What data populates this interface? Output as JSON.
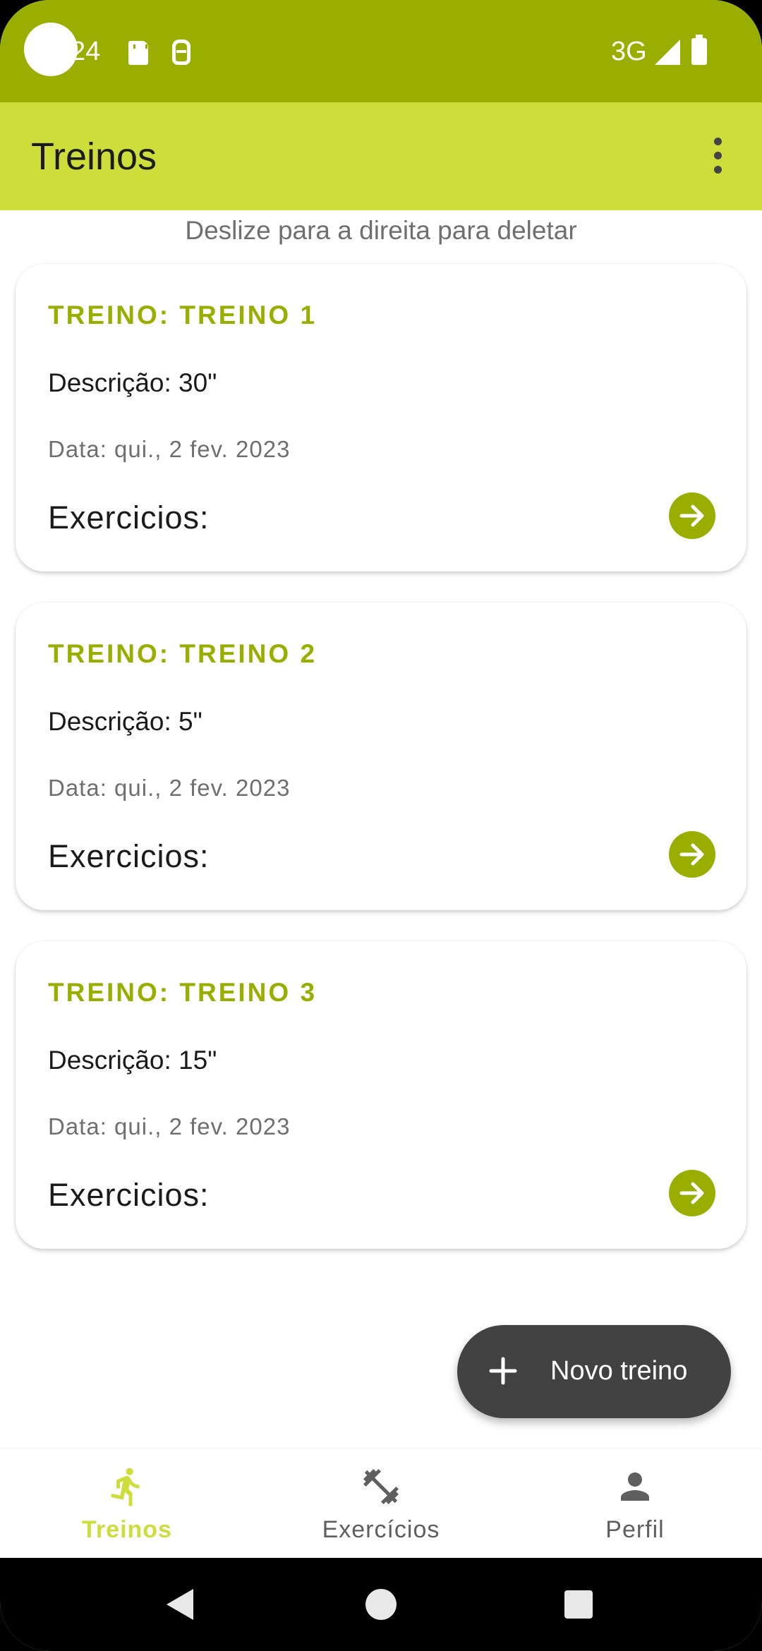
{
  "status_bar": {
    "time": "24",
    "network": "3G"
  },
  "app_bar": {
    "title": "Treinos",
    "menu_icon": "more-vert-icon"
  },
  "hint": "Deslize para a direita para deletar",
  "cards": [
    {
      "title": "TREINO: TREINO 1",
      "description": "Descrição: 30\"",
      "date": "Data: qui., 2 fev. 2023",
      "exercises": "Exercicios:",
      "action_icon": "arrow-forward-icon"
    },
    {
      "title": "TREINO: TREINO 2",
      "description": "Descrição: 5\"",
      "date": "Data: qui., 2 fev. 2023",
      "exercises": "Exercicios:",
      "action_icon": "arrow-forward-icon"
    },
    {
      "title": "TREINO: TREINO 3",
      "description": "Descrição: 15\"",
      "date": "Data: qui., 2 fev. 2023",
      "exercises": "Exercicios:",
      "action_icon": "arrow-forward-icon"
    }
  ],
  "fab": {
    "label": "Novo treino",
    "icon": "plus-icon"
  },
  "bottom_nav": {
    "items": [
      {
        "label": "Treinos",
        "icon": "running-icon",
        "active": true
      },
      {
        "label": "Exercícios",
        "icon": "dumbbell-icon",
        "active": false
      },
      {
        "label": "Perfil",
        "icon": "person-icon",
        "active": false
      }
    ]
  },
  "colors": {
    "status_bar": "#9aae00",
    "app_bar": "#cddd3a",
    "accent": "#9aae00",
    "active_nav": "#cddd3a",
    "fab": "#424242"
  }
}
